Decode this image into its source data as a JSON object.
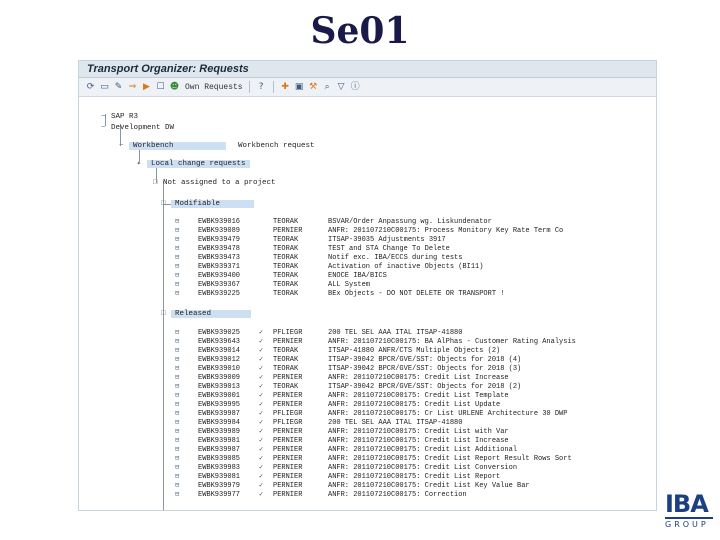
{
  "slide": {
    "title": "Se01"
  },
  "window": {
    "title": "Transport Organizer: Requests"
  },
  "toolbar": {
    "own_requests_label": "Own Requests",
    "icons": [
      "refresh-icon",
      "display-icon",
      "change-icon",
      "transport-icon",
      "release-icon",
      "checkbox-icon",
      "user-icon",
      "help-icon",
      "create-icon",
      "lock-icon",
      "tool-icon",
      "find-icon",
      "filter-icon",
      "info-icon"
    ]
  },
  "tree": {
    "system": "SAP R3",
    "client": "Development DW",
    "node_workbench": "Workbench",
    "node_workbench_desc": "Workbench request",
    "node_local": "Local change requests",
    "node_not_assigned": "Not assigned to a project",
    "node_modifiable": "Modifiable",
    "node_released": "Released"
  },
  "modifiable_rows": [
    {
      "request": "EWBK939016",
      "owner": "TEORAK",
      "desc": "BSVAR/Order Anpassung wg. Liskundenator"
    },
    {
      "request": "EWBK939089",
      "owner": "PERNIER",
      "desc": "ANFR: 201107210C00175: Process Monitory Key Rate Term Co"
    },
    {
      "request": "EWBK939479",
      "owner": "TEORAK",
      "desc": "ITSAP-39035 Adjustments 3917"
    },
    {
      "request": "EWBK939478",
      "owner": "TEORAK",
      "desc": "TEST and STA Change To Delete"
    },
    {
      "request": "EWBK939473",
      "owner": "TEORAK",
      "desc": "Notif exc. IBA/ECCS during tests"
    },
    {
      "request": "EWBK939371",
      "owner": "TEORAK",
      "desc": "Activation of inactive Objects (BI11)"
    },
    {
      "request": "EWBK939400",
      "owner": "TEORAK",
      "desc": "ENOCE IBA/BICS"
    },
    {
      "request": "EWBK939367",
      "owner": "TEORAK",
      "desc": "ALL System"
    },
    {
      "request": "EWBK939225",
      "owner": "TEORAK",
      "desc": "BEx Objects - DO NOT DELETE OR TRANSPORT !"
    }
  ],
  "released_rows": [
    {
      "request": "EWBK939025",
      "owner": "PFLIEGR",
      "desc": "200 TEL SEL AAA ITAL ITSAP-41880"
    },
    {
      "request": "EWBK939643",
      "owner": "PERNIER",
      "desc": "ANFR: 201107210C00175: BA AlPhas - Customer Rating Analysis"
    },
    {
      "request": "EWBK939014",
      "owner": "TEORAK",
      "desc": "ITSAP-41880 ANFR/CTS Multiple Objects (2)"
    },
    {
      "request": "EWBK939012",
      "owner": "TEORAK",
      "desc": "ITSAP-39042 BPCR/GVE/SST: Objects for 2018 (4)"
    },
    {
      "request": "EWBK939010",
      "owner": "TEORAK",
      "desc": "ITSAP-39042 BPCR/GVE/SST: Objects for 2018 (3)"
    },
    {
      "request": "EWBK939009",
      "owner": "PERNIER",
      "desc": "ANFR: 201107210C00175: Credit List Increase"
    },
    {
      "request": "EWBK939013",
      "owner": "TEORAK",
      "desc": "ITSAP-39042 BPCR/GVE/SST: Objects for 2018 (2)"
    },
    {
      "request": "EWBK939001",
      "owner": "PERNIER",
      "desc": "ANFR: 201107210C00175: Credit List Template"
    },
    {
      "request": "EWBK939995",
      "owner": "PERNIER",
      "desc": "ANFR: 201107210C00175: Credit List Update"
    },
    {
      "request": "EWBK939987",
      "owner": "PFLIEGR",
      "desc": "ANFR: 201107210C00175: Cr List URLENE Architecture 30 DWP"
    },
    {
      "request": "EWBK939984",
      "owner": "PFLIEGR",
      "desc": "200 TEL SEL AAA ITAL ITSAP-41880"
    },
    {
      "request": "EWBK939989",
      "owner": "PERNIER",
      "desc": "ANFR: 201107210C00175: Credit List with Var"
    },
    {
      "request": "EWBK939981",
      "owner": "PERNIER",
      "desc": "ANFR: 201107210C00175: Credit List Increase"
    },
    {
      "request": "EWBK939987",
      "owner": "PERNIER",
      "desc": "ANFR: 201107210C00175: Credit List Additional"
    },
    {
      "request": "EWBK939085",
      "owner": "PERNIER",
      "desc": "ANFR: 201107210C00175: Credit List Report Result Rows Sort"
    },
    {
      "request": "EWBK939983",
      "owner": "PERNIER",
      "desc": "ANFR: 201107210C00175: Credit List Conversion"
    },
    {
      "request": "EWBK939081",
      "owner": "PERNIER",
      "desc": "ANFR: 201107210C00175: Credit List Report"
    },
    {
      "request": "EWBK939979",
      "owner": "PERNIER",
      "desc": "ANFR: 201107210C00175: Credit List Key Value Bar"
    },
    {
      "request": "EWBK939977",
      "owner": "PERNIER",
      "desc": "ANFR: 201107210C00175: Correction"
    }
  ],
  "logo": {
    "main": "IBA",
    "sub": "GROUP"
  },
  "colors": {
    "title": "#1a1a4a",
    "highlight": "#cde0f3",
    "logo": "#1b3f80"
  }
}
